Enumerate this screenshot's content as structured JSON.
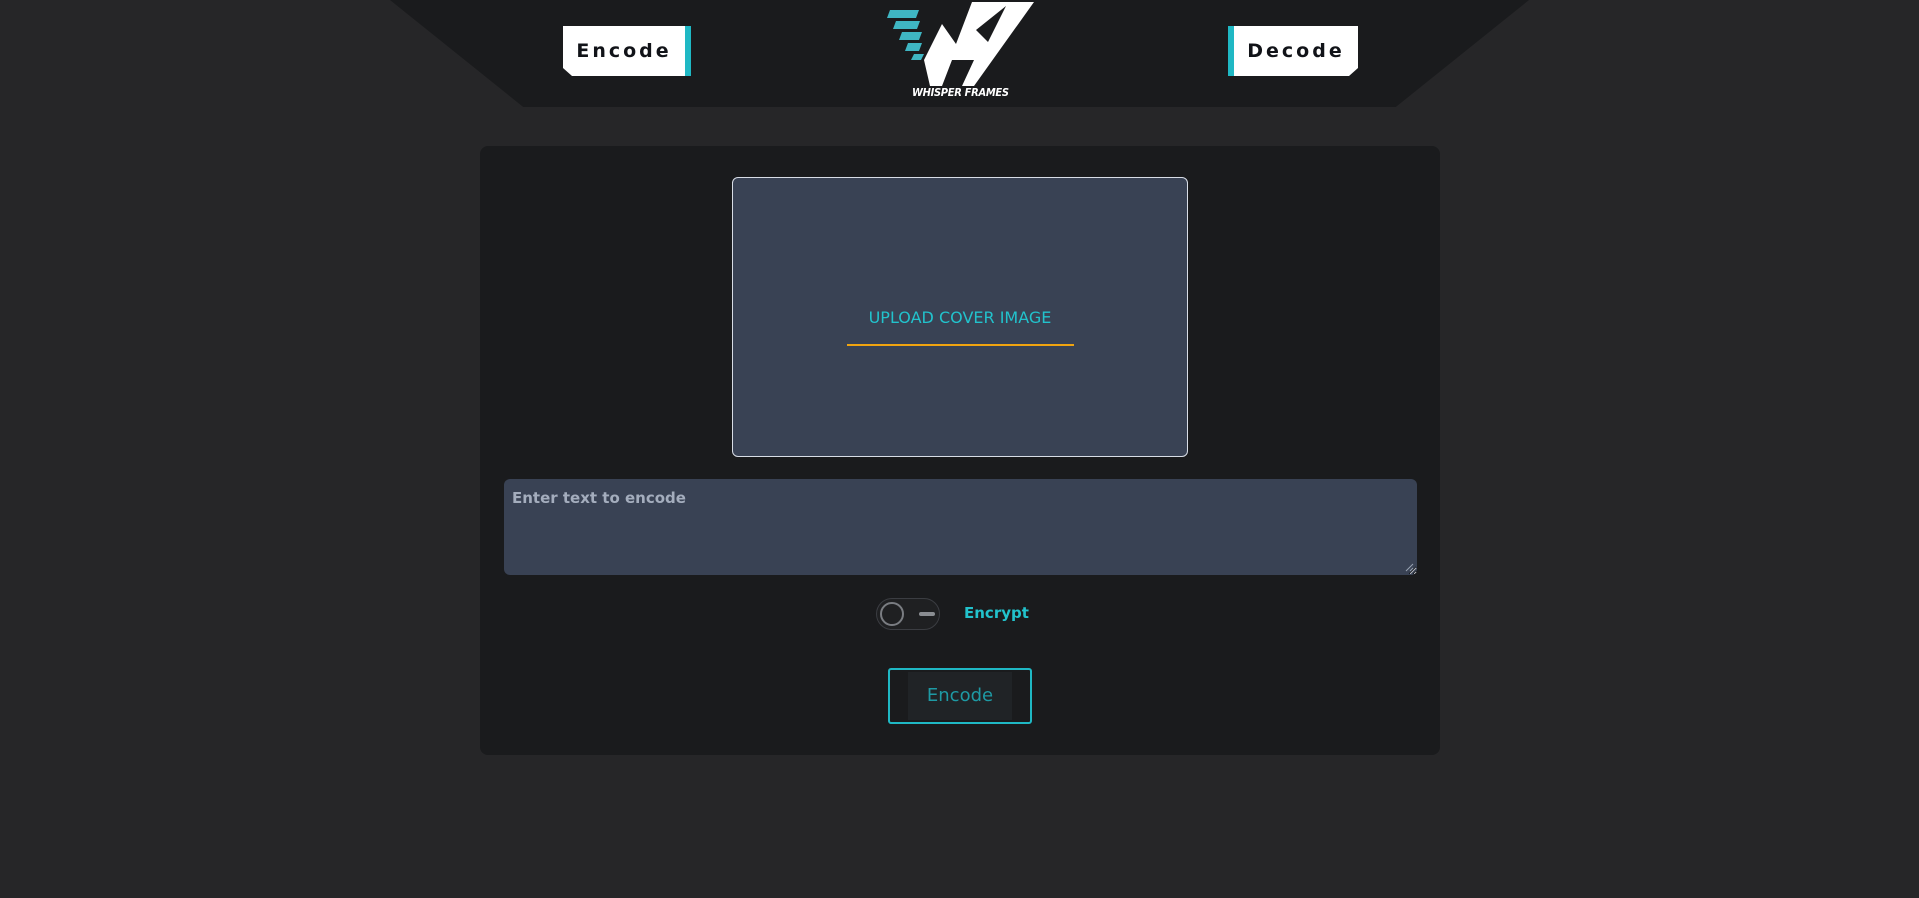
{
  "header": {
    "encode_tab": "Encode",
    "decode_tab": "Decode",
    "logo_text": "WHISPER FRAMES"
  },
  "upload": {
    "label": "UPLOAD COVER IMAGE"
  },
  "message": {
    "placeholder": "Enter text to encode",
    "value": ""
  },
  "encrypt": {
    "label": "Encrypt",
    "enabled": false
  },
  "actions": {
    "encode_label": "Encode"
  },
  "colors": {
    "background": "#262628",
    "panel": "#1a1b1d",
    "accent_teal": "#1fb8c4",
    "accent_orange": "#f0a410",
    "field": "#394254"
  },
  "icons": {
    "logo": "whisper-frames-logo-icon",
    "toggle": "toggle-switch-icon",
    "resize": "resize-grip-icon"
  }
}
